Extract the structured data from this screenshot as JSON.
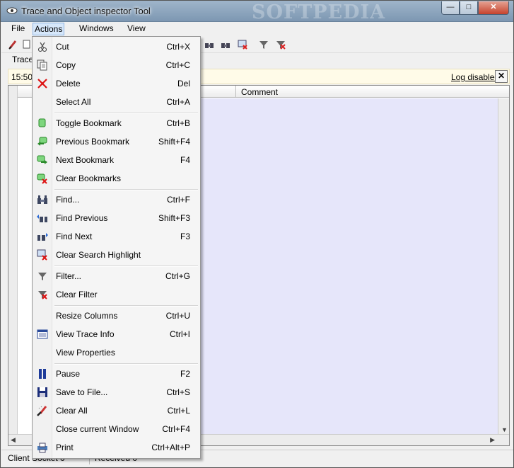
{
  "window": {
    "title": "Trace and Object inspector Tool",
    "watermark": "SOFTPEDIA",
    "close_glyph": "✕",
    "min_glyph": "—",
    "max_glyph": "□"
  },
  "menubar": {
    "file": "File",
    "actions": "Actions",
    "windows": "Windows",
    "view": "View"
  },
  "tab": {
    "label": "Trace"
  },
  "infobar": {
    "time": "15:50:",
    "log_status": "Log disabled",
    "close": "✕"
  },
  "grid": {
    "columns": [
      "Comment"
    ]
  },
  "status": {
    "client": "Client Socket 0",
    "received": "Received 0"
  },
  "actions_menu": [
    {
      "label": "Cut",
      "shortcut": "Ctrl+X",
      "icon": "scissors-icon"
    },
    {
      "label": "Copy",
      "shortcut": "Ctrl+C",
      "icon": "copy-icon"
    },
    {
      "label": "Delete",
      "shortcut": "Del",
      "icon": "delete-x-icon"
    },
    {
      "label": "Select All",
      "shortcut": "Ctrl+A",
      "icon": ""
    },
    {
      "label": "Toggle Bookmark",
      "shortcut": "Ctrl+B",
      "icon": "bookmark-icon"
    },
    {
      "label": "Previous Bookmark",
      "shortcut": "Shift+F4",
      "icon": "previous-bookmark-icon"
    },
    {
      "label": "Next Bookmark",
      "shortcut": "F4",
      "icon": "next-bookmark-icon"
    },
    {
      "label": "Clear Bookmarks",
      "shortcut": "",
      "icon": "clear-bookmarks-icon"
    },
    {
      "label": "Find...",
      "shortcut": "Ctrl+F",
      "icon": "binoculars-icon"
    },
    {
      "label": "Find Previous",
      "shortcut": "Shift+F3",
      "icon": "find-previous-icon"
    },
    {
      "label": "Find Next",
      "shortcut": "F3",
      "icon": "find-next-icon"
    },
    {
      "label": "Clear Search Highlight",
      "shortcut": "",
      "icon": "clear-highlight-icon"
    },
    {
      "label": "Filter...",
      "shortcut": "Ctrl+G",
      "icon": "filter-icon"
    },
    {
      "label": "Clear Filter",
      "shortcut": "",
      "icon": "clear-filter-icon"
    },
    {
      "label": "Resize Columns",
      "shortcut": "Ctrl+U",
      "icon": ""
    },
    {
      "label": "View Trace Info",
      "shortcut": "Ctrl+I",
      "icon": "trace-info-icon"
    },
    {
      "label": "View Properties",
      "shortcut": "",
      "icon": ""
    },
    {
      "label": "Pause",
      "shortcut": "F2",
      "icon": "pause-icon"
    },
    {
      "label": "Save to File...",
      "shortcut": "Ctrl+S",
      "icon": "floppy-disk-icon"
    },
    {
      "label": "Clear All",
      "shortcut": "Ctrl+L",
      "icon": "brush-icon"
    },
    {
      "label": "Close current Window",
      "shortcut": "Ctrl+F4",
      "icon": ""
    },
    {
      "label": "Print",
      "shortcut": "Ctrl+Alt+P",
      "icon": "printer-icon"
    }
  ]
}
